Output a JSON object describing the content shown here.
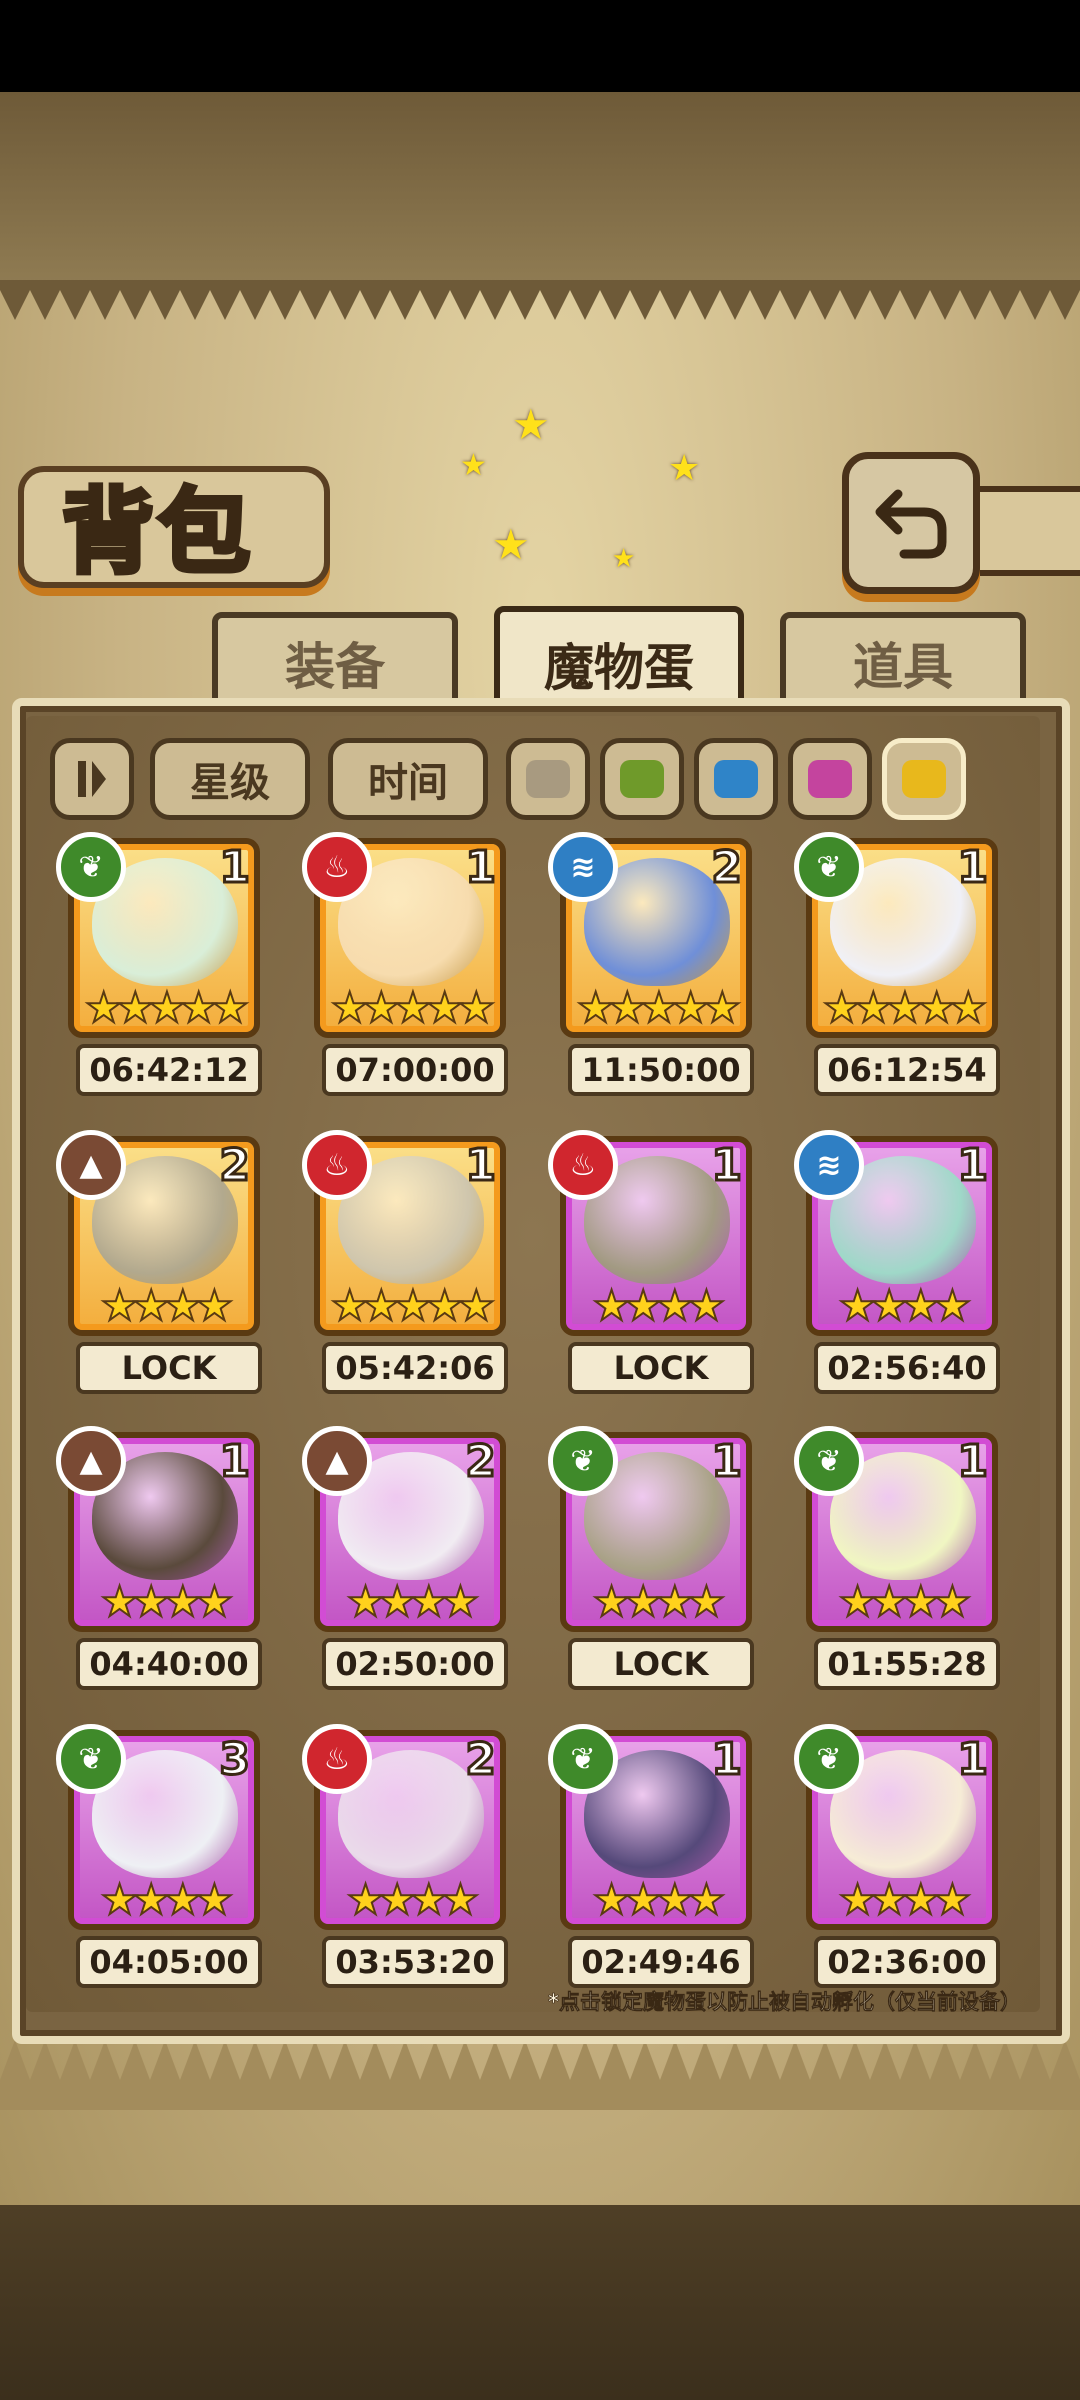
{
  "header": {
    "title": "背包"
  },
  "tabs": [
    {
      "label": "装备",
      "active": false
    },
    {
      "label": "魔物蛋",
      "active": true
    },
    {
      "label": "道具",
      "active": false
    }
  ],
  "filters": {
    "sort_icon": "sort-toggle-icon",
    "star_label": "星级",
    "time_label": "时间",
    "color_swatches": [
      "#a89a80",
      "#6f9a2a",
      "#2f84c8",
      "#c4449e",
      "#e8b81c"
    ]
  },
  "eggs": [
    {
      "element": "leaf",
      "count": "1",
      "stars": "★★★★★",
      "timer": "06:42:12",
      "rarity": "orange",
      "art": "#d9eed8"
    },
    {
      "element": "fire",
      "count": "1",
      "stars": "★★★★★",
      "timer": "07:00:00",
      "rarity": "orange",
      "art": "#f7dcae"
    },
    {
      "element": "water",
      "count": "2",
      "stars": "★★★★★",
      "timer": "11:50:00",
      "rarity": "orange",
      "art": "#6f8fd8"
    },
    {
      "element": "leaf",
      "count": "1",
      "stars": "★★★★★",
      "timer": "06:12:54",
      "rarity": "orange",
      "art": "#f0f0f6"
    },
    {
      "element": "earth",
      "count": "2",
      "stars": "★★★★",
      "timer": "LOCK",
      "rarity": "orange",
      "art": "#b2a98e"
    },
    {
      "element": "fire",
      "count": "1",
      "stars": "★★★★★",
      "timer": "05:42:06",
      "rarity": "orange",
      "art": "#cfc6ad"
    },
    {
      "element": "fire",
      "count": "1",
      "stars": "★★★★",
      "timer": "LOCK",
      "rarity": "purple",
      "art": "#a29a82"
    },
    {
      "element": "water",
      "count": "1",
      "stars": "★★★★",
      "timer": "02:56:40",
      "rarity": "purple",
      "art": "#9fd8c8"
    },
    {
      "element": "earth",
      "count": "1",
      "stars": "★★★★",
      "timer": "04:40:00",
      "rarity": "purple",
      "art": "#5a4a3c"
    },
    {
      "element": "earth",
      "count": "2",
      "stars": "★★★★",
      "timer": "02:50:00",
      "rarity": "purple",
      "art": "#f1ecf2"
    },
    {
      "element": "leaf",
      "count": "1",
      "stars": "★★★★",
      "timer": "LOCK",
      "rarity": "purple",
      "art": "#a9a287"
    },
    {
      "element": "leaf",
      "count": "1",
      "stars": "★★★★",
      "timer": "01:55:28",
      "rarity": "purple",
      "art": "#f0f6c2"
    },
    {
      "element": "leaf",
      "count": "3",
      "stars": "★★★★",
      "timer": "04:05:00",
      "rarity": "purple",
      "art": "#eef0f4"
    },
    {
      "element": "fire",
      "count": "2",
      "stars": "★★★★",
      "timer": "03:53:20",
      "rarity": "purple",
      "art": "#eadbea"
    },
    {
      "element": "leaf",
      "count": "1",
      "stars": "★★★★",
      "timer": "02:49:46",
      "rarity": "purple",
      "art": "#55497a"
    },
    {
      "element": "leaf",
      "count": "1",
      "stars": "★★★★",
      "timer": "02:36:00",
      "rarity": "purple",
      "art": "#f6ecd6"
    }
  ],
  "footnote": "*点击锁定魔物蛋以防止被自动孵化（仅当前设备）"
}
